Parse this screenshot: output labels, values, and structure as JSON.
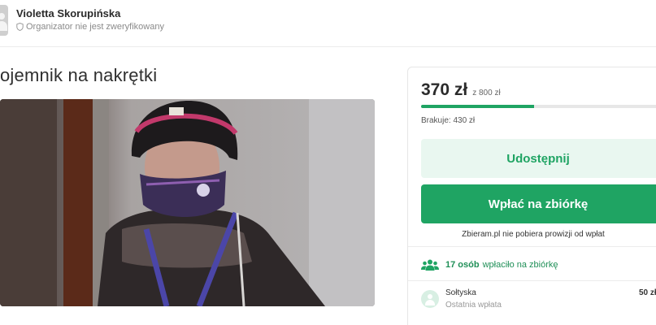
{
  "organizer": {
    "name": "Violetta Skorupińska",
    "status": "Organizator nie jest zweryfikowany",
    "avatar_icon": "user-avatar-icon",
    "status_icon": "shield-icon"
  },
  "campaign": {
    "title": "ojemnik na nakrętki",
    "photo_description_icon": "campaign-photo"
  },
  "panel": {
    "amount": "370 zł",
    "goal": "z 800 zł",
    "progress_fraction": 0.4625,
    "missing": "Brakuje: 430 zł",
    "share_label": "Udostępnij",
    "donate_label": "Wpłać na zbiórkę",
    "fee_note": "Zbieram.pl nie pobiera prowizji od wpłat",
    "donors_count": "17 osób",
    "donors_text": "wpłaciło na zbiórkę",
    "donors_icon": "people-icon",
    "last_donor": {
      "name": "Sołtyska",
      "subtitle": "Ostatnia wpłata",
      "amount": "50 zł"
    }
  },
  "colors": {
    "accent": "#1fa463",
    "accent_light": "#e9f7f0"
  }
}
